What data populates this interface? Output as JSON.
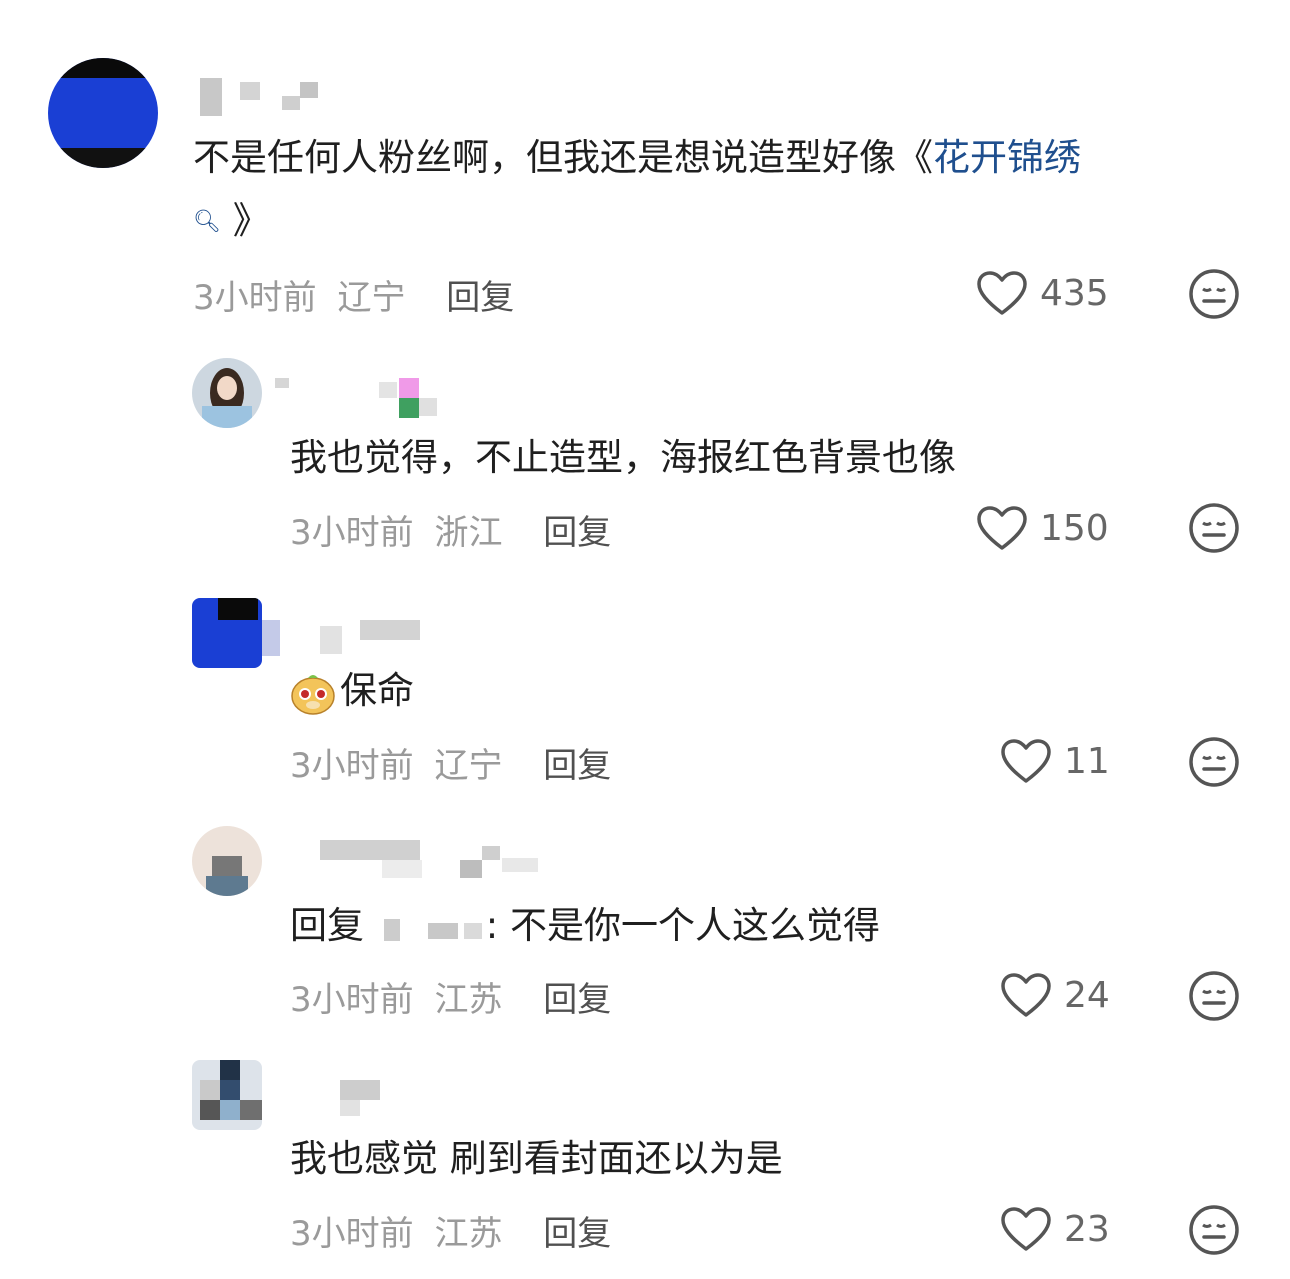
{
  "comments": [
    {
      "text_a": "不是任何人粉丝啊，但我还是想说造型好像《",
      "link": "花开锦绣",
      "text_b": "》",
      "time": "3小时前",
      "location": "辽宁",
      "reply": "回复",
      "likes": "435"
    },
    {
      "text": "我也觉得，不止造型，海报红色背景也像",
      "time": "3小时前",
      "location": "浙江",
      "reply": "回复",
      "likes": "150"
    },
    {
      "text": "保命",
      "time": "3小时前",
      "location": "辽宁",
      "reply": "回复",
      "likes": "11"
    },
    {
      "reply_prefix": "回复",
      "text": ": 不是你一个人这么觉得",
      "time": "3小时前",
      "location": "江苏",
      "reply": "回复",
      "likes": "24"
    },
    {
      "text": "我也感觉 刷到看封面还以为是",
      "time": "3小时前",
      "location": "江苏",
      "reply": "回复",
      "likes": "23"
    }
  ],
  "icons": {
    "like": "heart-outline-icon",
    "dislike": "neutral-face-icon",
    "search": "search-icon",
    "emoji": "dog-face-emoji"
  },
  "colors": {
    "link": "#1f4f8e",
    "meta": "#9a9a9a"
  }
}
